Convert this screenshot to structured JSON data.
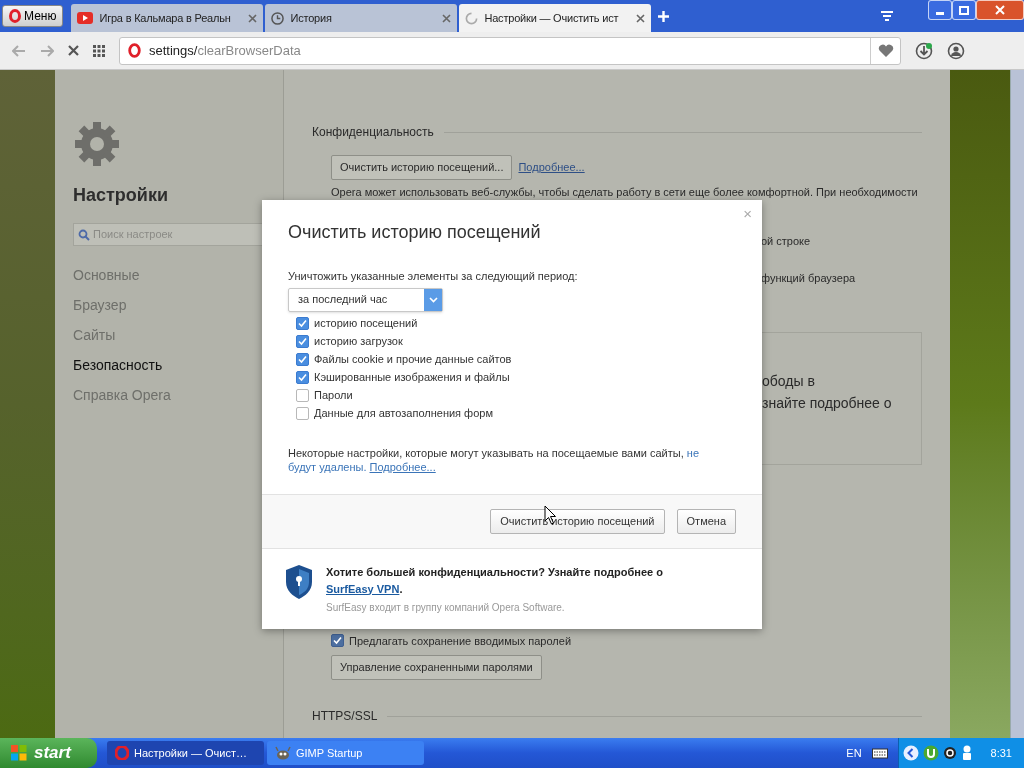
{
  "browser": {
    "menu_label": "Меню",
    "tabs": [
      {
        "label": "Игра в Кальмара в Реальн",
        "kind": "video",
        "selected": false
      },
      {
        "label": "История",
        "kind": "history",
        "selected": false
      },
      {
        "label": "Настройки — Очистить ист",
        "kind": "loading",
        "selected": true
      }
    ],
    "address": {
      "host": "settings/",
      "path": "clearBrowserData"
    }
  },
  "sidebar": {
    "title": "Настройки",
    "search_placeholder": "Поиск настроек",
    "items": [
      {
        "label": "Основные",
        "selected": false
      },
      {
        "label": "Браузер",
        "selected": false
      },
      {
        "label": "Сайты",
        "selected": false
      },
      {
        "label": "Безопасность",
        "selected": true
      },
      {
        "label": "Справка Opera",
        "selected": false
      }
    ]
  },
  "main": {
    "section_title": "Конфиденциальность",
    "clear_button": "Очистить историю посещений...",
    "more_link": "Подробнее...",
    "description": "Opera может использовать веб-службы, чтобы сделать работу в сети еще более комфортной. При необходимости",
    "fragments": [
      "ой строке",
      "функций браузера"
    ],
    "panel_fragments": [
      "ободы в",
      "знайте подробнее о"
    ],
    "save_passwords": {
      "label": "Предлагать сохранение вводимых паролей",
      "checked": true
    },
    "manage_passwords": "Управление сохраненными паролями",
    "https_title": "HTTPS/SSL"
  },
  "dialog": {
    "title": "Очистить историю посещений",
    "close": "×",
    "period_label": "Уничтожить указанные элементы за следующий период:",
    "period": "за последний час",
    "options": [
      {
        "label": "историю посещений",
        "checked": true
      },
      {
        "label": "историю загрузок",
        "checked": true
      },
      {
        "label": "Файлы cookie и прочие данные сайтов",
        "checked": true
      },
      {
        "label": "Кэшированные изображения и файлы",
        "checked": true
      },
      {
        "label": "Пароли",
        "checked": false
      },
      {
        "label": "Данные для автозаполнения форм",
        "checked": false
      }
    ],
    "note": "Некоторые настройки, которые могут указывать на посещаемые вами сайты,",
    "note_link": "не будут удалены.",
    "note_more": "Подробнее...",
    "confirm": "Очистить историю посещений",
    "cancel": "Отмена",
    "promo_title": "Хотите большей конфиденциальности? Узнайте подробнее о",
    "promo_link": "SurfEasy VPN",
    "promo_dot": ".",
    "promo_sub": "SurfEasy входит в группу компаний Opera Software."
  },
  "taskbar": {
    "start": "start",
    "tasks": [
      {
        "label": "Настройки — Очист…",
        "kind": "opera",
        "selected": true
      },
      {
        "label": "GIMP Startup",
        "kind": "gimp",
        "selected": false
      }
    ],
    "lang": "EN",
    "time": "8:31"
  }
}
